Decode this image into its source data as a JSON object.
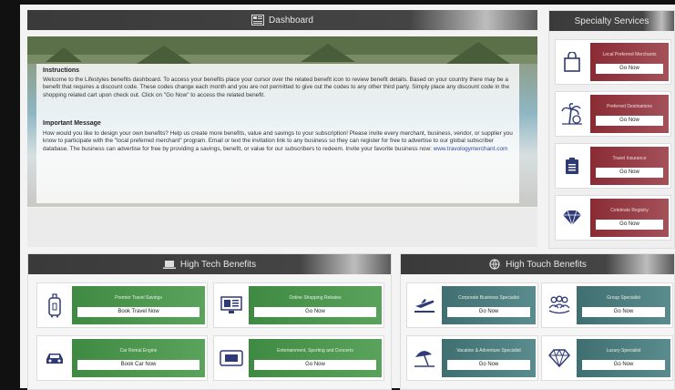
{
  "dashboard": {
    "title": "Dashboard"
  },
  "instructions": {
    "heading": "Instructions",
    "body": "Welcome to the Lifestyles benefits dashboard. To access your benefits place your cursor over the related benefit icon to review benefit details. Based on your country there may be a benefit that requires a discount code. These codes change each month and you are not permitted to give out the codes to any other third party. Simply place any discount code in the shopping related cart upon check out. Click on \"Go Now\" to access the related benefit."
  },
  "important": {
    "heading": "Important Message",
    "body": "How would you like to design your own benefits? Help us create more benefits, value and savings to your subscription! Please invite every merchant, business, vendor, or supplier you know to participate with the \"local preferred merchant\" program. Email or text the invitation link to any business so they can register for free to advertise to our global subscriber database. The business can advertise for free by providing a savings, benefit, or value for our subscribers to redeem. Invite your favorite business now:",
    "link": "www.travologymerchant.com"
  },
  "specialty": {
    "title": "Specialty Services",
    "items": [
      {
        "label": "Local Preferred Merchants",
        "button": "Go Now",
        "icon": "shopping-bag-icon"
      },
      {
        "label": "Preferred Destinations",
        "button": "Go Now",
        "icon": "palm-tree-icon"
      },
      {
        "label": "Travel Insurance",
        "button": "Go Now",
        "icon": "clipboard-icon"
      },
      {
        "label": "Celebrate Registry",
        "button": "Go Now",
        "icon": "diamond-icon"
      }
    ]
  },
  "hightech": {
    "title": "High Tech Benefits",
    "items": [
      {
        "label": "Premier Travel Savings",
        "button": "Book Travel Now",
        "icon": "luggage-icon"
      },
      {
        "label": "Online Shopping Rebates",
        "button": "Go Now",
        "icon": "monitor-icon"
      },
      {
        "label": "Car Rental Engine",
        "button": "Book Car Now",
        "icon": "car-icon"
      },
      {
        "label": "Entertainment, Sporting and Concerts",
        "button": "Go Now",
        "icon": "ticket-icon"
      }
    ]
  },
  "hightouch": {
    "title": "High Touch Benefits",
    "items": [
      {
        "label": "Corporate Business Specialist",
        "button": "Go Now",
        "icon": "airplane-icon"
      },
      {
        "label": "Group Specialist",
        "button": "Go Now",
        "icon": "group-icon"
      },
      {
        "label": "Vacation & Adventure Specialist",
        "button": "Go Now",
        "icon": "beach-umbrella-icon"
      },
      {
        "label": "Luxury Specialist",
        "button": "Go Now",
        "icon": "diamond-icon"
      }
    ]
  },
  "colors": {
    "specialty_card": "#8a2b34",
    "hightech_card": "#3f8a42",
    "hightouch_card": "#3f6f70",
    "header_bar": "#3a3a3a",
    "link": "#2a4fa0"
  }
}
